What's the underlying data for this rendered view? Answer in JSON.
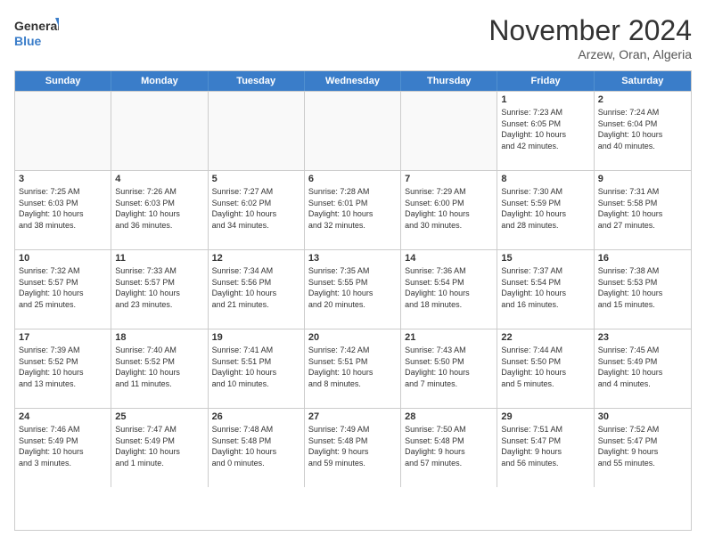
{
  "header": {
    "logo_text_general": "General",
    "logo_text_blue": "Blue",
    "month_title": "November 2024",
    "subtitle": "Arzew, Oran, Algeria"
  },
  "weekdays": [
    "Sunday",
    "Monday",
    "Tuesday",
    "Wednesday",
    "Thursday",
    "Friday",
    "Saturday"
  ],
  "weeks": [
    [
      {
        "day": "",
        "info": ""
      },
      {
        "day": "",
        "info": ""
      },
      {
        "day": "",
        "info": ""
      },
      {
        "day": "",
        "info": ""
      },
      {
        "day": "",
        "info": ""
      },
      {
        "day": "1",
        "info": "Sunrise: 7:23 AM\nSunset: 6:05 PM\nDaylight: 10 hours\nand 42 minutes."
      },
      {
        "day": "2",
        "info": "Sunrise: 7:24 AM\nSunset: 6:04 PM\nDaylight: 10 hours\nand 40 minutes."
      }
    ],
    [
      {
        "day": "3",
        "info": "Sunrise: 7:25 AM\nSunset: 6:03 PM\nDaylight: 10 hours\nand 38 minutes."
      },
      {
        "day": "4",
        "info": "Sunrise: 7:26 AM\nSunset: 6:03 PM\nDaylight: 10 hours\nand 36 minutes."
      },
      {
        "day": "5",
        "info": "Sunrise: 7:27 AM\nSunset: 6:02 PM\nDaylight: 10 hours\nand 34 minutes."
      },
      {
        "day": "6",
        "info": "Sunrise: 7:28 AM\nSunset: 6:01 PM\nDaylight: 10 hours\nand 32 minutes."
      },
      {
        "day": "7",
        "info": "Sunrise: 7:29 AM\nSunset: 6:00 PM\nDaylight: 10 hours\nand 30 minutes."
      },
      {
        "day": "8",
        "info": "Sunrise: 7:30 AM\nSunset: 5:59 PM\nDaylight: 10 hours\nand 28 minutes."
      },
      {
        "day": "9",
        "info": "Sunrise: 7:31 AM\nSunset: 5:58 PM\nDaylight: 10 hours\nand 27 minutes."
      }
    ],
    [
      {
        "day": "10",
        "info": "Sunrise: 7:32 AM\nSunset: 5:57 PM\nDaylight: 10 hours\nand 25 minutes."
      },
      {
        "day": "11",
        "info": "Sunrise: 7:33 AM\nSunset: 5:57 PM\nDaylight: 10 hours\nand 23 minutes."
      },
      {
        "day": "12",
        "info": "Sunrise: 7:34 AM\nSunset: 5:56 PM\nDaylight: 10 hours\nand 21 minutes."
      },
      {
        "day": "13",
        "info": "Sunrise: 7:35 AM\nSunset: 5:55 PM\nDaylight: 10 hours\nand 20 minutes."
      },
      {
        "day": "14",
        "info": "Sunrise: 7:36 AM\nSunset: 5:54 PM\nDaylight: 10 hours\nand 18 minutes."
      },
      {
        "day": "15",
        "info": "Sunrise: 7:37 AM\nSunset: 5:54 PM\nDaylight: 10 hours\nand 16 minutes."
      },
      {
        "day": "16",
        "info": "Sunrise: 7:38 AM\nSunset: 5:53 PM\nDaylight: 10 hours\nand 15 minutes."
      }
    ],
    [
      {
        "day": "17",
        "info": "Sunrise: 7:39 AM\nSunset: 5:52 PM\nDaylight: 10 hours\nand 13 minutes."
      },
      {
        "day": "18",
        "info": "Sunrise: 7:40 AM\nSunset: 5:52 PM\nDaylight: 10 hours\nand 11 minutes."
      },
      {
        "day": "19",
        "info": "Sunrise: 7:41 AM\nSunset: 5:51 PM\nDaylight: 10 hours\nand 10 minutes."
      },
      {
        "day": "20",
        "info": "Sunrise: 7:42 AM\nSunset: 5:51 PM\nDaylight: 10 hours\nand 8 minutes."
      },
      {
        "day": "21",
        "info": "Sunrise: 7:43 AM\nSunset: 5:50 PM\nDaylight: 10 hours\nand 7 minutes."
      },
      {
        "day": "22",
        "info": "Sunrise: 7:44 AM\nSunset: 5:50 PM\nDaylight: 10 hours\nand 5 minutes."
      },
      {
        "day": "23",
        "info": "Sunrise: 7:45 AM\nSunset: 5:49 PM\nDaylight: 10 hours\nand 4 minutes."
      }
    ],
    [
      {
        "day": "24",
        "info": "Sunrise: 7:46 AM\nSunset: 5:49 PM\nDaylight: 10 hours\nand 3 minutes."
      },
      {
        "day": "25",
        "info": "Sunrise: 7:47 AM\nSunset: 5:49 PM\nDaylight: 10 hours\nand 1 minute."
      },
      {
        "day": "26",
        "info": "Sunrise: 7:48 AM\nSunset: 5:48 PM\nDaylight: 10 hours\nand 0 minutes."
      },
      {
        "day": "27",
        "info": "Sunrise: 7:49 AM\nSunset: 5:48 PM\nDaylight: 9 hours\nand 59 minutes."
      },
      {
        "day": "28",
        "info": "Sunrise: 7:50 AM\nSunset: 5:48 PM\nDaylight: 9 hours\nand 57 minutes."
      },
      {
        "day": "29",
        "info": "Sunrise: 7:51 AM\nSunset: 5:47 PM\nDaylight: 9 hours\nand 56 minutes."
      },
      {
        "day": "30",
        "info": "Sunrise: 7:52 AM\nSunset: 5:47 PM\nDaylight: 9 hours\nand 55 minutes."
      }
    ]
  ]
}
